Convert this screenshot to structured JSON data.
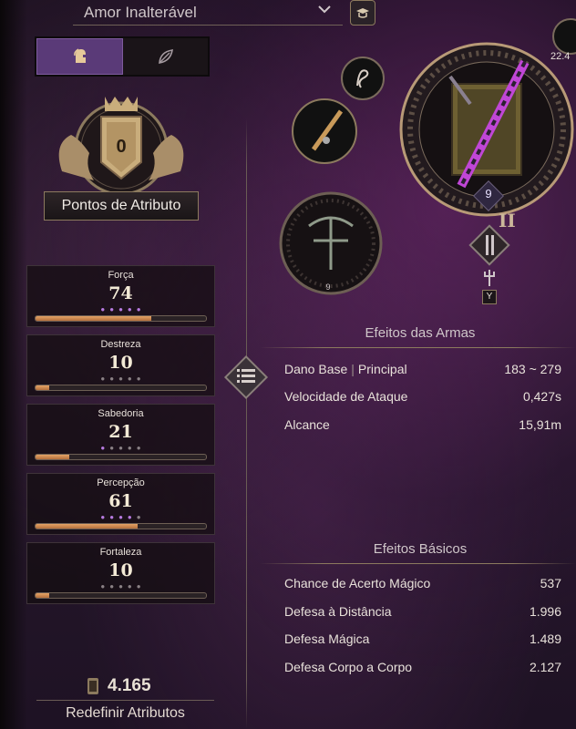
{
  "header": {
    "dropdown_value": "Amor Inalterável"
  },
  "toggle": {
    "options": [
      "character-icon",
      "leaf-icon"
    ],
    "active_index": 0
  },
  "attribute_points": {
    "label": "Pontos de Atributo",
    "value": "0"
  },
  "attributes": [
    {
      "name": "Força",
      "value": "74",
      "pips_filled": 5,
      "pips_total": 5,
      "bar_fraction": 0.68
    },
    {
      "name": "Destreza",
      "value": "10",
      "pips_filled": 0,
      "pips_total": 5,
      "bar_fraction": 0.08
    },
    {
      "name": "Sabedoria",
      "value": "21",
      "pips_filled": 1,
      "pips_total": 5,
      "bar_fraction": 0.2
    },
    {
      "name": "Percepção",
      "value": "61",
      "pips_filled": 4,
      "pips_total": 5,
      "bar_fraction": 0.6
    },
    {
      "name": "Fortaleza",
      "value": "10",
      "pips_filled": 0,
      "pips_total": 5,
      "bar_fraction": 0.08
    }
  ],
  "footer": {
    "currency": "4.165",
    "reset_label": "Redefinir Atributos"
  },
  "equipment": {
    "main_weapon_level": "9",
    "main_weapon_tier": "II",
    "secondary_weapon_level": "9",
    "top_right_value": "22.4",
    "swap_key": "Y"
  },
  "weapon_effects": {
    "title": "Efeitos das Armas",
    "rows": [
      {
        "label": "Dano Base",
        "tag": "Principal",
        "value": "183 ~ 279"
      },
      {
        "label": "Velocidade de Ataque",
        "tag": "",
        "value": "0,427s"
      },
      {
        "label": "Alcance",
        "tag": "",
        "value": "15,91m"
      }
    ]
  },
  "basic_effects": {
    "title": "Efeitos Básicos",
    "rows": [
      {
        "label": "Chance de Acerto Mágico",
        "value": "537"
      },
      {
        "label": "Defesa à Distância",
        "value": "1.996"
      },
      {
        "label": "Defesa Mágica",
        "value": "1.489"
      },
      {
        "label": "Defesa Corpo a Corpo",
        "value": "2.127"
      }
    ]
  },
  "colors": {
    "accent_purple": "#5a3a78",
    "bar_orange": "#d99558",
    "pip_purple": "#b77be0",
    "pip_grey": "#8a8185",
    "gold_trim": "#8c7a5e"
  }
}
